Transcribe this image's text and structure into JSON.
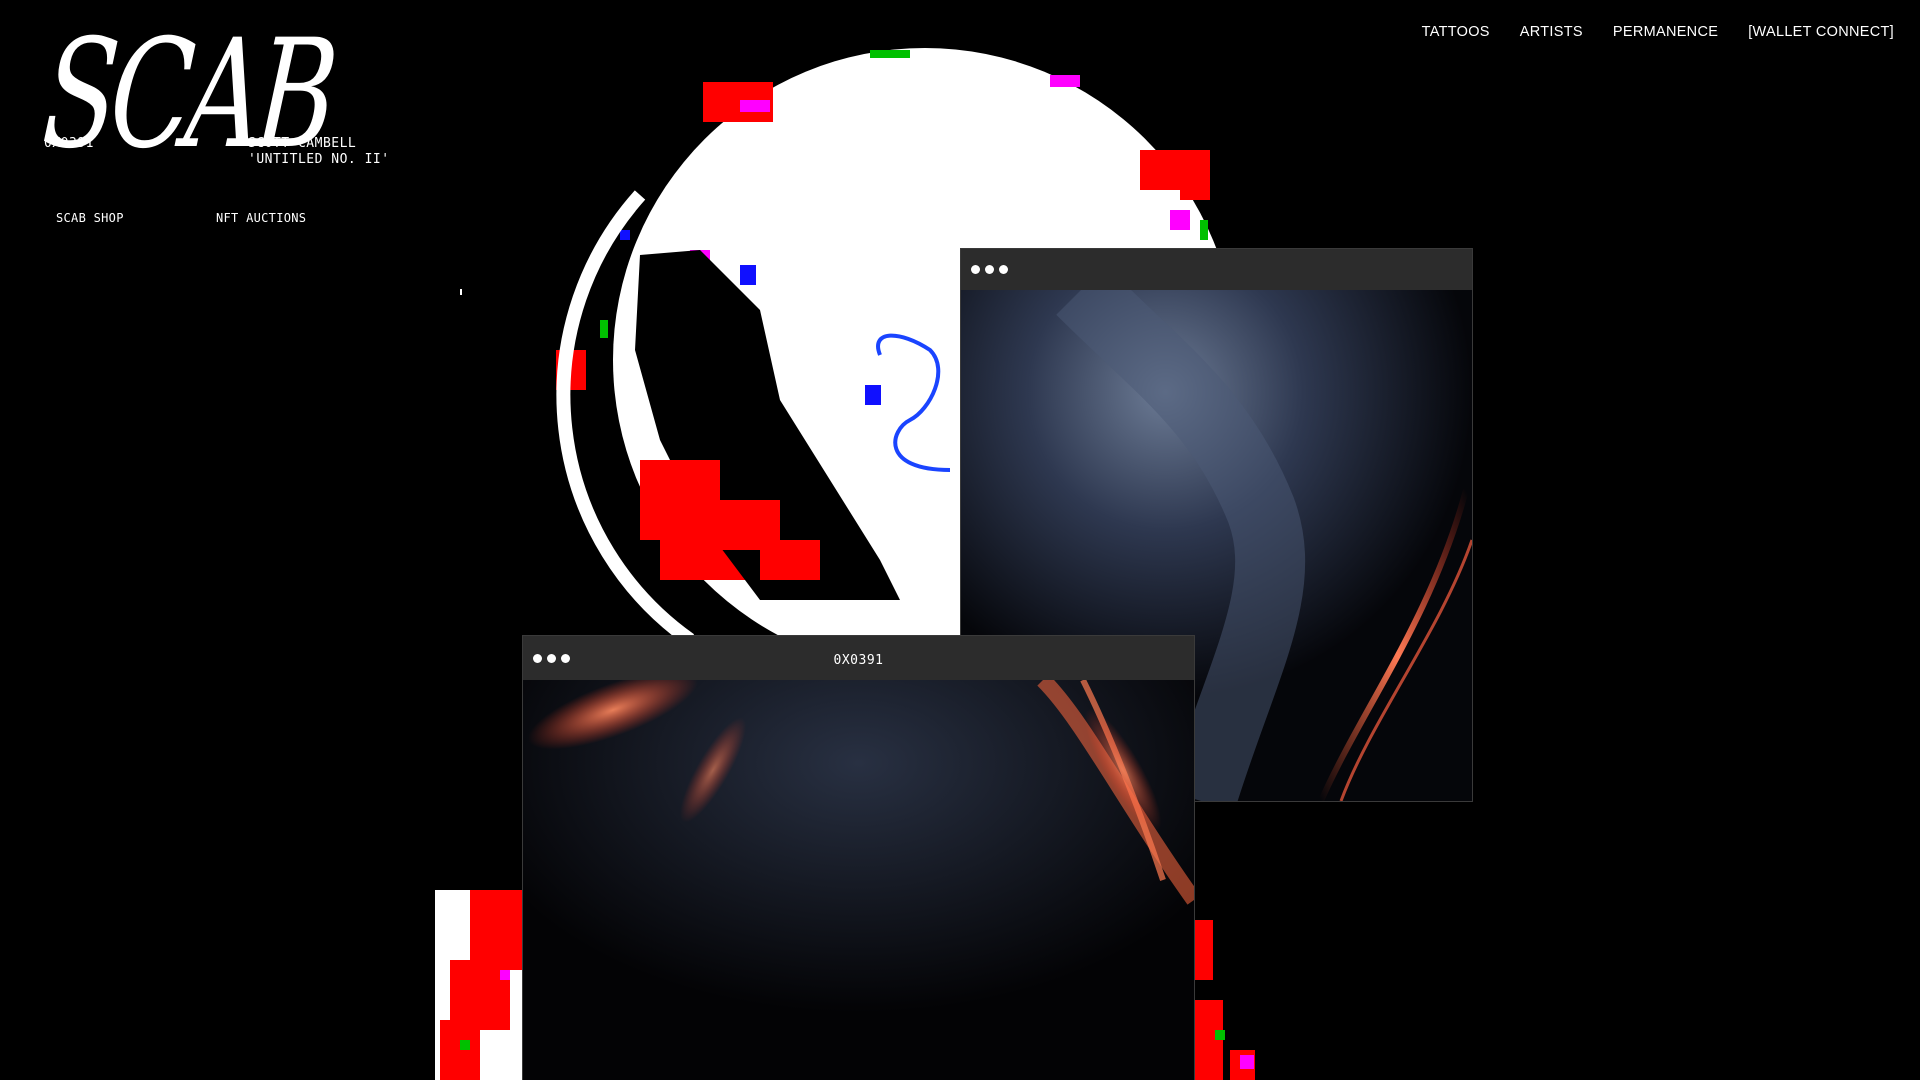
{
  "brand": {
    "logo_text": "SCAB",
    "token_id": "0X0391",
    "artist_name": "SCOTT CAMBELL",
    "artwork_title": "'UNTITLED NO. II'"
  },
  "subnav": {
    "shop_label": "SCAB SHOP",
    "auctions_label": "NFT AUCTIONS"
  },
  "topnav": {
    "items": [
      "TATTOOS",
      "ARTISTS",
      "PERMANENCE",
      "[WALLET CONNECT]"
    ]
  },
  "windows": {
    "right": {
      "title": ""
    },
    "left": {
      "title": "0X0391"
    }
  },
  "colors": {
    "background": "#000000",
    "window_bar": "#2c2c2c",
    "glitch_red": "#ff0000",
    "glitch_magenta": "#ff00ff",
    "glow_orange": "#ff6a3d",
    "smoke_blue": "#4a5a78"
  }
}
